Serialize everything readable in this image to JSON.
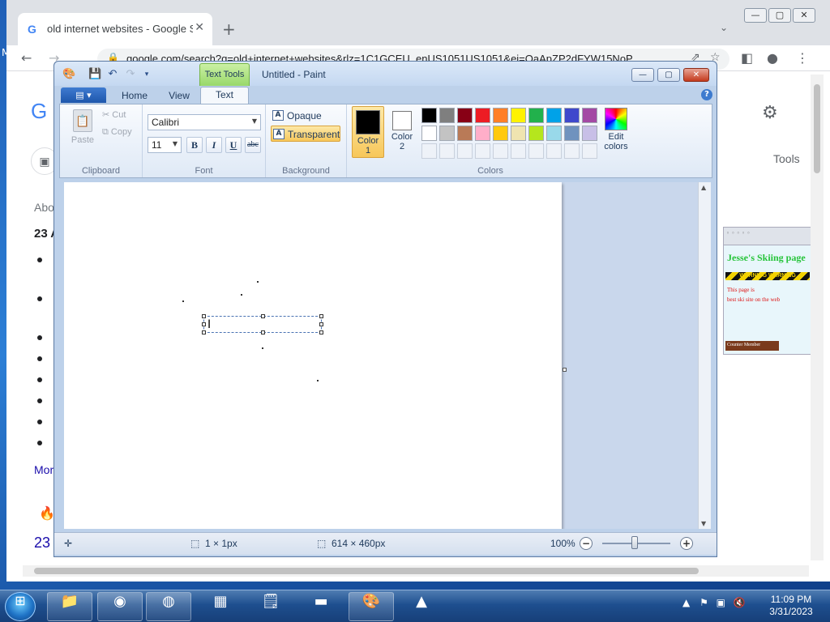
{
  "chrome": {
    "tab_title": "old internet websites - Google Se",
    "tab_close": "✕",
    "new_tab": "+",
    "tab_list": "⌄",
    "win_minimize": "—",
    "win_maximize": "▢",
    "win_close": "✕",
    "url": "google.com/search?q=old+internet+websites&rlz=1C1GCEU_enUS1051US1051&ei=OaApZP2dFYW15NoP"
  },
  "google_page": {
    "logo_letter": "G",
    "about": "Abo",
    "heading": "23 A",
    "more": "Mor",
    "result_number": "23",
    "tools": "Tools",
    "thumbnail": {
      "title": "Jesse's Skiing page",
      "warning": "WARNING  WARNING",
      "line1": "This page is",
      "line2": "best ski site on the web",
      "counter": "Counter Member"
    }
  },
  "desktop": {
    "left_letter": "M"
  },
  "paint": {
    "title": "Untitled - Paint",
    "context_tab": "Text Tools",
    "tabs": [
      "Home",
      "View",
      "Text"
    ],
    "active_tab": "Text",
    "clipboard": {
      "paste": "Paste",
      "cut": "Cut",
      "copy": "Copy",
      "label": "Clipboard"
    },
    "font": {
      "family": "Calibri",
      "size": "11",
      "bold": "B",
      "italic": "I",
      "underline": "U",
      "strike": "abc",
      "label": "Font"
    },
    "background": {
      "opaque": "Opaque",
      "transparent": "Transparent",
      "label": "Background",
      "selected": "Transparent"
    },
    "colors": {
      "color1_label": "Color 1",
      "color1_line1": "Color",
      "color1_line2": "1",
      "color2_line1": "Color",
      "color2_line2": "2",
      "color1_value": "#000000",
      "color2_value": "#ffffff",
      "edit_line1": "Edit",
      "edit_line2": "colors",
      "label": "Colors",
      "palette_row1": [
        "#000000",
        "#7f7f7f",
        "#880015",
        "#ed1c24",
        "#ff7f27",
        "#fff200",
        "#22b14c",
        "#00a2e8",
        "#3f48cc",
        "#a349a4"
      ],
      "palette_row2": [
        "#ffffff",
        "#c3c3c3",
        "#b97a57",
        "#ffaec9",
        "#ffc90e",
        "#efe4b0",
        "#b5e61d",
        "#99d9ea",
        "#7092be",
        "#c8bfe7"
      ]
    },
    "status": {
      "selection_size": "1 × 1px",
      "canvas_size": "614 × 460px",
      "zoom": "100%"
    }
  },
  "taskbar": {
    "time": "11:09 PM",
    "date": "3/31/2023"
  }
}
